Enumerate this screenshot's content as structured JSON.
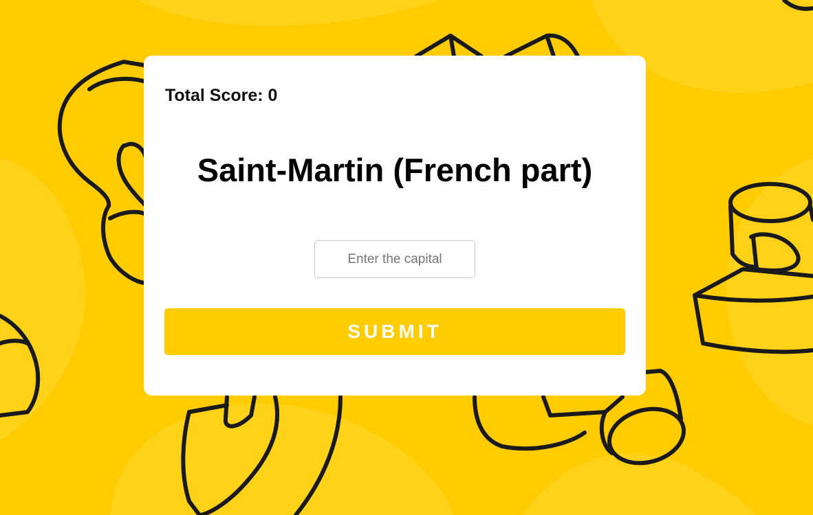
{
  "page": {
    "background_color": "#ffcc00",
    "accent_color": "#ffcc00"
  },
  "quiz": {
    "score_text": "Total Score: 0",
    "country": "Saint-Martin (French part)",
    "input_placeholder": "Enter the capital",
    "input_value": "",
    "submit_label": "SUBMIT"
  }
}
